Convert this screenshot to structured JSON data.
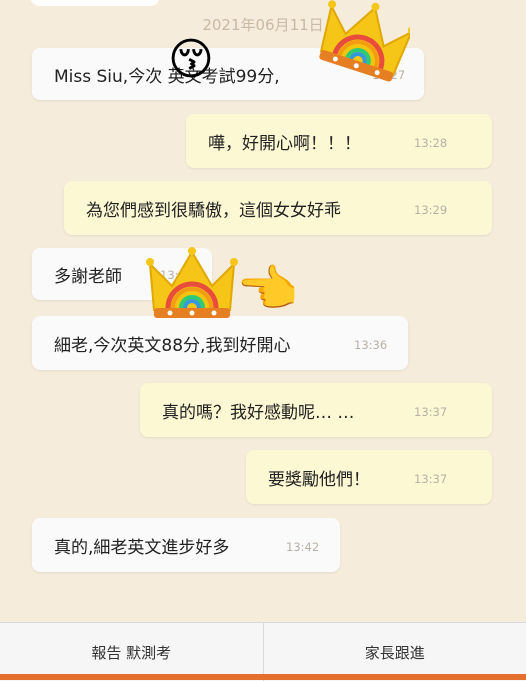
{
  "date_label": "2021年06月11日",
  "messages": [
    {
      "text": "Miss Siu,今次       英文考試99分,",
      "time": "13:27"
    },
    {
      "text": "嘩，好開心啊！！！",
      "time": "13:28"
    },
    {
      "text": "為您們感到很驕傲，這個女女好乖",
      "time": "13:29"
    },
    {
      "text": "多謝老師",
      "time": "13:3"
    },
    {
      "text": "細老,今次英文88分,我到好開心",
      "time": "13:36"
    },
    {
      "text": "真的嗎？我好感動呢… …",
      "time": "13:37"
    },
    {
      "text": "要獎勵他們！",
      "time": "13:37"
    },
    {
      "text": "真的,細老英文進步好多",
      "time": "13:42"
    }
  ],
  "stickers": {
    "kiss_face": "😚",
    "pointing_hand": "👉"
  },
  "bottom_bar": {
    "left_label": "報告 默測考",
    "right_label": "家長跟進"
  },
  "colors": {
    "background": "#f6ecdb",
    "incoming_bubble": "#fafafa",
    "outgoing_bubble": "#fcf8d4",
    "accent": "#e56f2f"
  }
}
